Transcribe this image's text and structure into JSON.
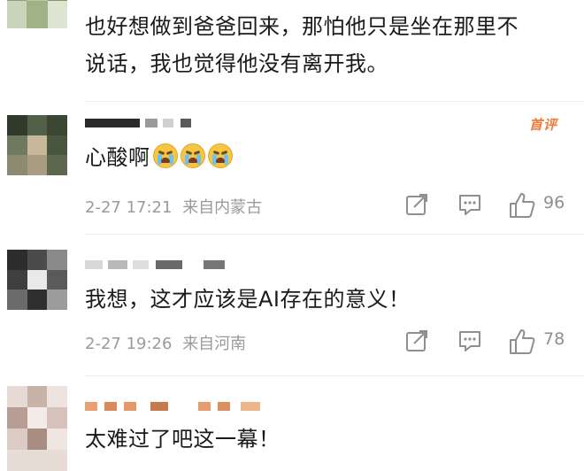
{
  "comments": [
    {
      "text_line1": "也好想做到爸爸回来，那怕他只是坐在那里不",
      "text_line2": "说话，我也觉得他没有离开我。"
    },
    {
      "text": "心酸啊",
      "emojis": [
        "crying-face",
        "crying-face",
        "crying-face"
      ],
      "badge": "首评",
      "time": "2-27 17:21",
      "location": "来自内蒙古",
      "likes": "96"
    },
    {
      "text": "我想，这才应该是AI存在的意义！",
      "time": "2-27 19:26",
      "location": "来自河南",
      "likes": "78"
    },
    {
      "text": "太难过了吧这一幕！"
    }
  ],
  "icons": {
    "share": "share-icon",
    "comment": "comment-icon",
    "like": "thumbs-up-icon"
  }
}
